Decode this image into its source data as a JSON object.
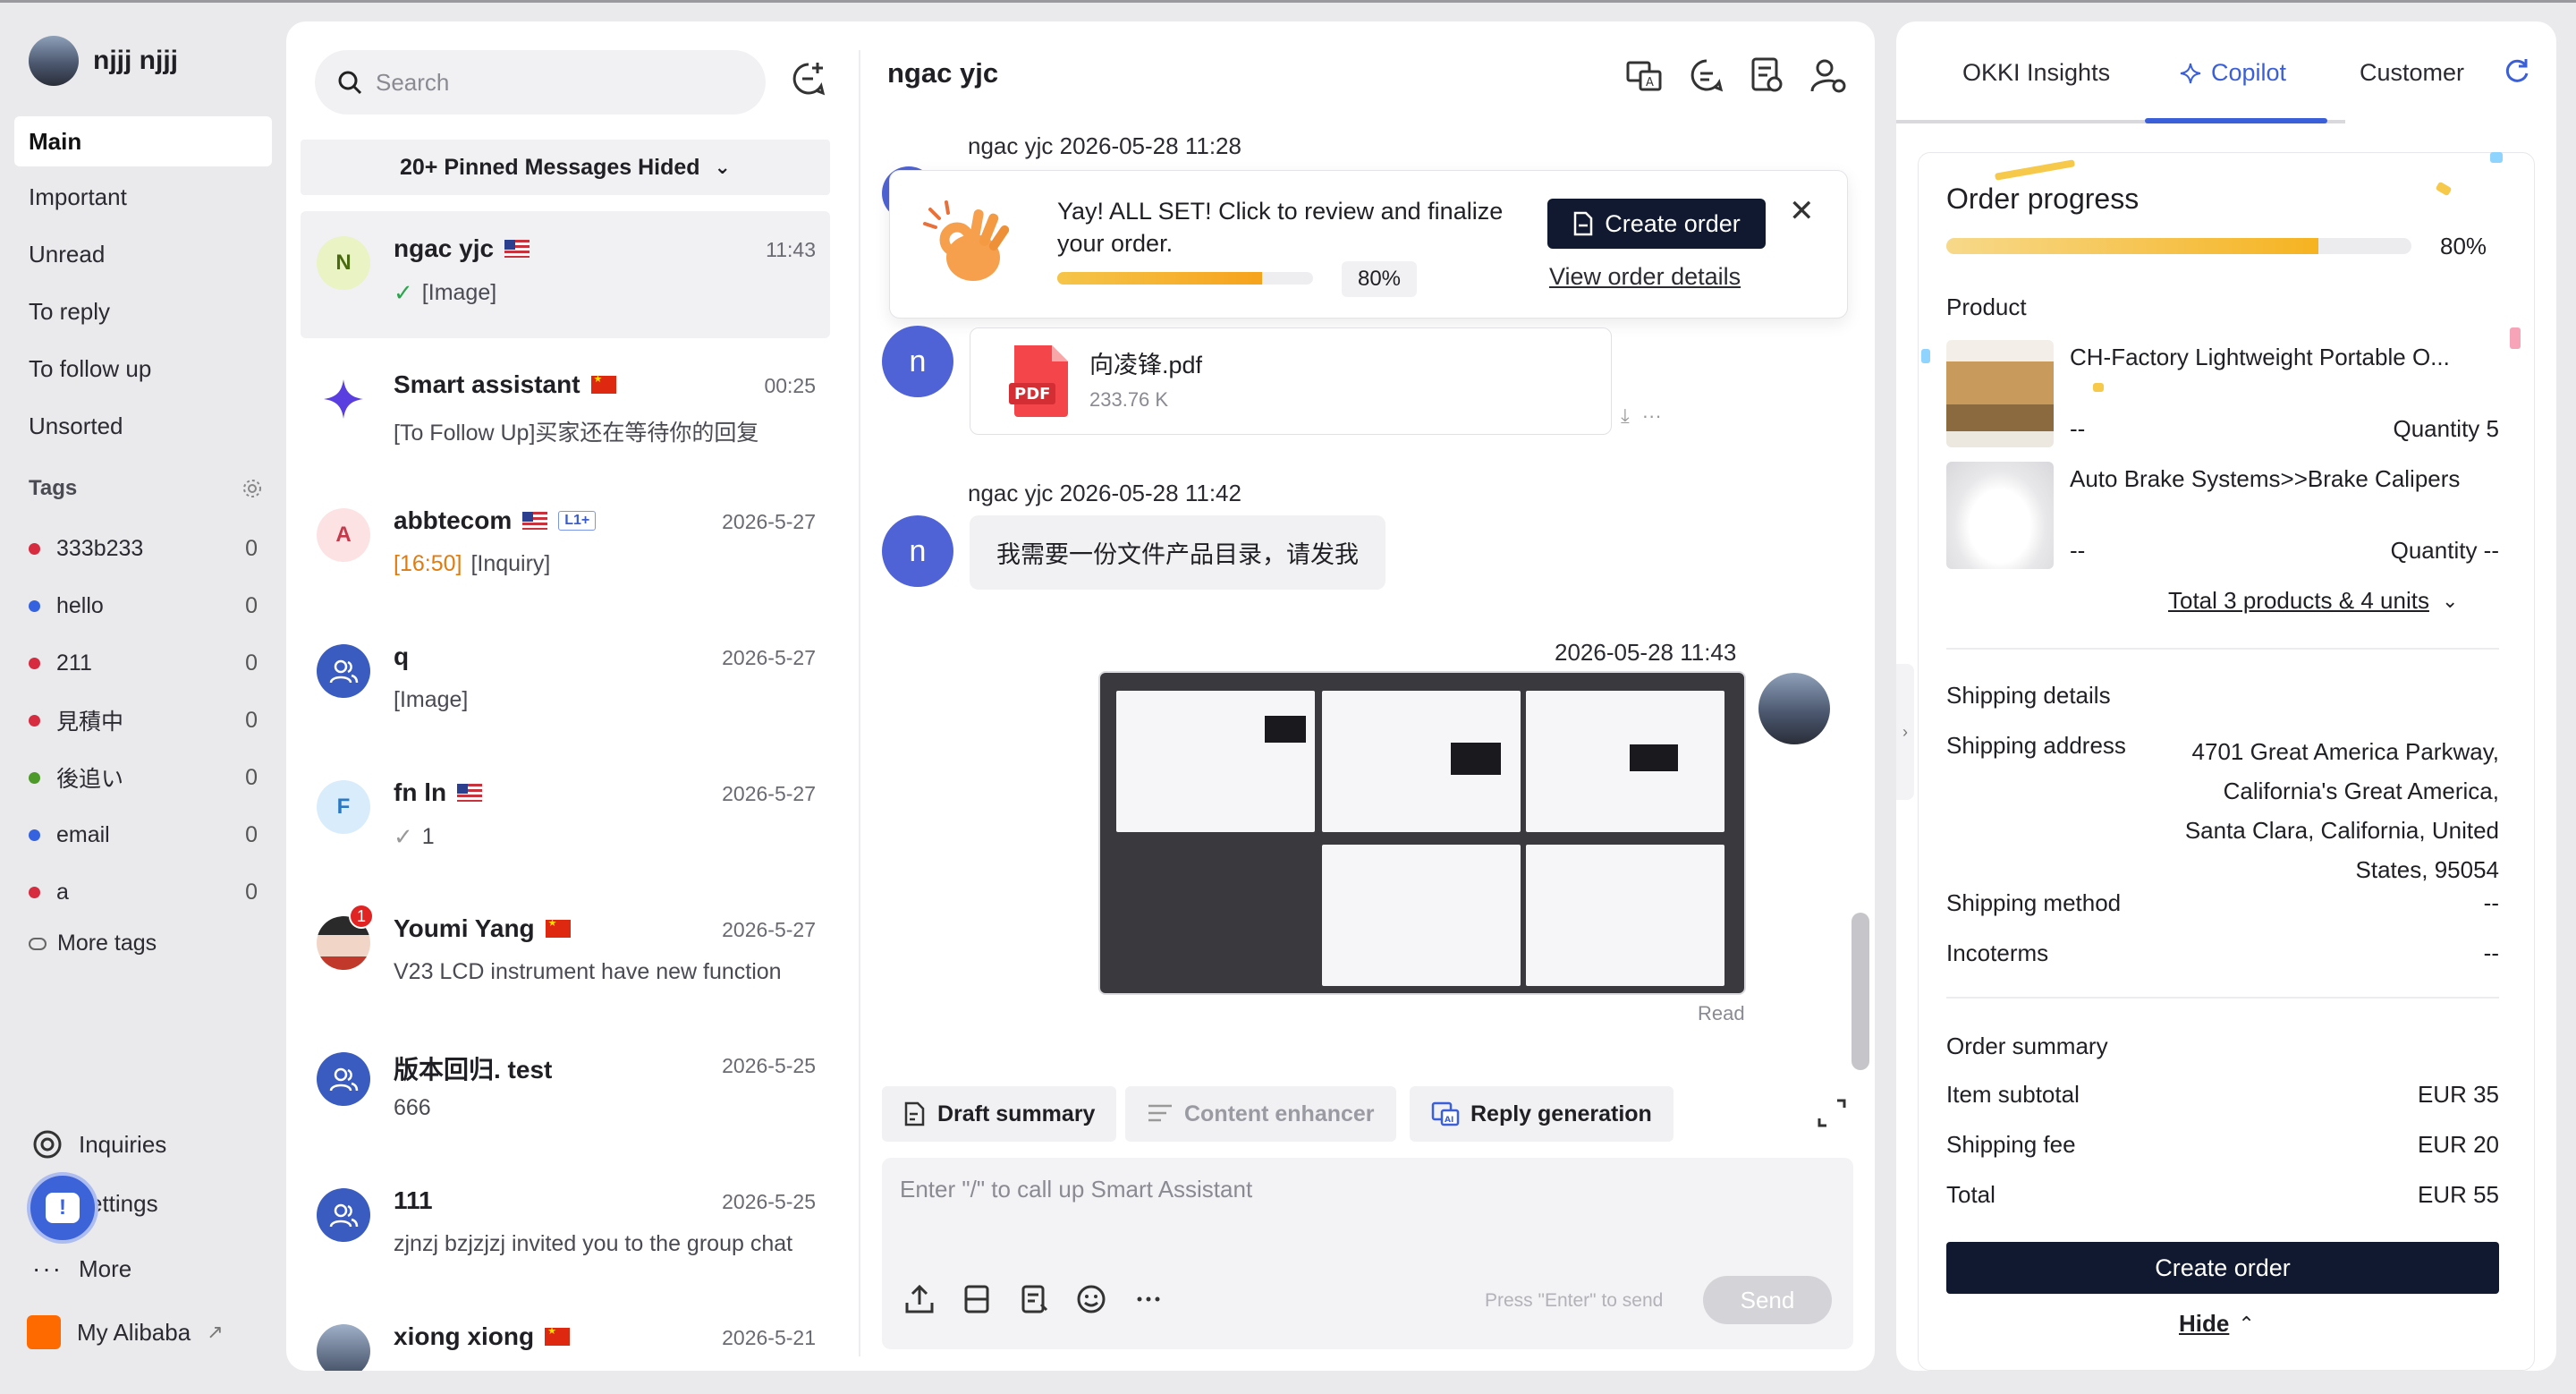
{
  "user": {
    "name": "njjj njjj"
  },
  "nav": {
    "items": [
      "Main",
      "Important",
      "Unread",
      "To reply",
      "To follow up",
      "Unsorted"
    ],
    "tags_header": "Tags",
    "tags": [
      {
        "label": "333b233",
        "count": "0",
        "color": "#d72b3f"
      },
      {
        "label": "hello",
        "count": "0",
        "color": "#3563e0"
      },
      {
        "label": "211",
        "count": "0",
        "color": "#d72b3f"
      },
      {
        "label": "見積中",
        "count": "0",
        "color": "#d72b3f"
      },
      {
        "label": "後追い",
        "count": "0",
        "color": "#4d9a2a"
      },
      {
        "label": "email",
        "count": "0",
        "color": "#3563e0"
      },
      {
        "label": "a",
        "count": "0",
        "color": "#d72b3f"
      }
    ],
    "more_tags": "More tags",
    "inquiries": "Inquiries",
    "settings": "ettings",
    "more": "More",
    "alibaba": "My Alibaba"
  },
  "search": {
    "placeholder": "Search"
  },
  "pinned": {
    "label": "20+ Pinned Messages Hided"
  },
  "conversations": [
    {
      "name": "ngac yjc",
      "initial": "N",
      "time": "11:43",
      "preview": "[Image]",
      "flag": "us"
    },
    {
      "name": "Smart assistant",
      "initial": "",
      "time": "00:25",
      "preview": "[To Follow Up]买家还在等待你的回复",
      "flag": "cn"
    },
    {
      "name": "abbtecom",
      "initial": "A",
      "time": "2026-5-27",
      "preview_tag": "[16:50]",
      "preview": "[Inquiry]",
      "flag": "us",
      "level": "L1+"
    },
    {
      "name": "q",
      "initial": "",
      "time": "2026-5-27",
      "preview": "[Image]"
    },
    {
      "name": "fn ln",
      "initial": "F",
      "time": "2026-5-27",
      "preview": "1",
      "flag": "us"
    },
    {
      "name": "Youmi Yang",
      "initial": "",
      "time": "2026-5-27",
      "preview": "V23 LCD instrument have new function",
      "flag": "cn",
      "badge": "1"
    },
    {
      "name": "版本回归. test",
      "initial": "",
      "time": "2026-5-25",
      "preview": "666"
    },
    {
      "name": "111",
      "initial": "",
      "time": "2026-5-25",
      "preview": "zjnzj bzjzjzj invited you to the group chat"
    },
    {
      "name": "xiong xiong",
      "initial": "",
      "time": "2026-5-21",
      "preview": "",
      "flag": "cn"
    }
  ],
  "chat": {
    "title": "ngac yjc",
    "msg1_meta": "ngac yjc   2026-05-28 11:28",
    "order_popup": {
      "text": "Yay! ALL SET! Click to review and finalize your order.",
      "progress_pct": "80%",
      "progress": 0.8,
      "button": "Create order",
      "link": "View order details"
    },
    "avatar_letter": "n",
    "file": {
      "name": "向凌锋.pdf",
      "size": "233.76 K",
      "type": "PDF"
    },
    "msg2_meta": "ngac yjc   2026-05-28 11:42",
    "msg2_text": "我需要一份文件产品目录，请发我",
    "msg3_meta": "2026-05-28 11:43",
    "read": "Read",
    "tools": [
      "Draft summary",
      "Content enhancer",
      "Reply generation"
    ],
    "composer_placeholder": "Enter \"/\" to call up Smart Assistant",
    "press_hint": "Press \"Enter\" to send",
    "send": "Send"
  },
  "right": {
    "tabs": [
      "OKKI Insights",
      "Copilot",
      "Customer"
    ],
    "order_progress": {
      "title": "Order progress",
      "pct": "80%",
      "value": 0.8
    },
    "product_label": "Product",
    "products": [
      {
        "name": "CH-Factory Lightweight Portable O...",
        "price": "--",
        "qty": "Quantity 5"
      },
      {
        "name": "Auto Brake Systems>>Brake Calipers",
        "price": "--",
        "qty": "Quantity --"
      }
    ],
    "total_products": "Total 3 products & 4 units",
    "shipping": {
      "title": "Shipping details",
      "address_label": "Shipping address",
      "address": [
        "4701 Great America Parkway,",
        "California's Great America,",
        "Santa Clara, California, United",
        "States, 95054"
      ],
      "method_label": "Shipping method",
      "method": "--",
      "incoterms_label": "Incoterms",
      "incoterms": "--"
    },
    "summary": {
      "title": "Order summary",
      "rows": [
        {
          "label": "Item subtotal",
          "value": "EUR 35"
        },
        {
          "label": "Shipping fee",
          "value": "EUR 20"
        },
        {
          "label": "Total",
          "value": "EUR 55"
        }
      ]
    },
    "create_order": "Create order",
    "hide": "Hide"
  }
}
